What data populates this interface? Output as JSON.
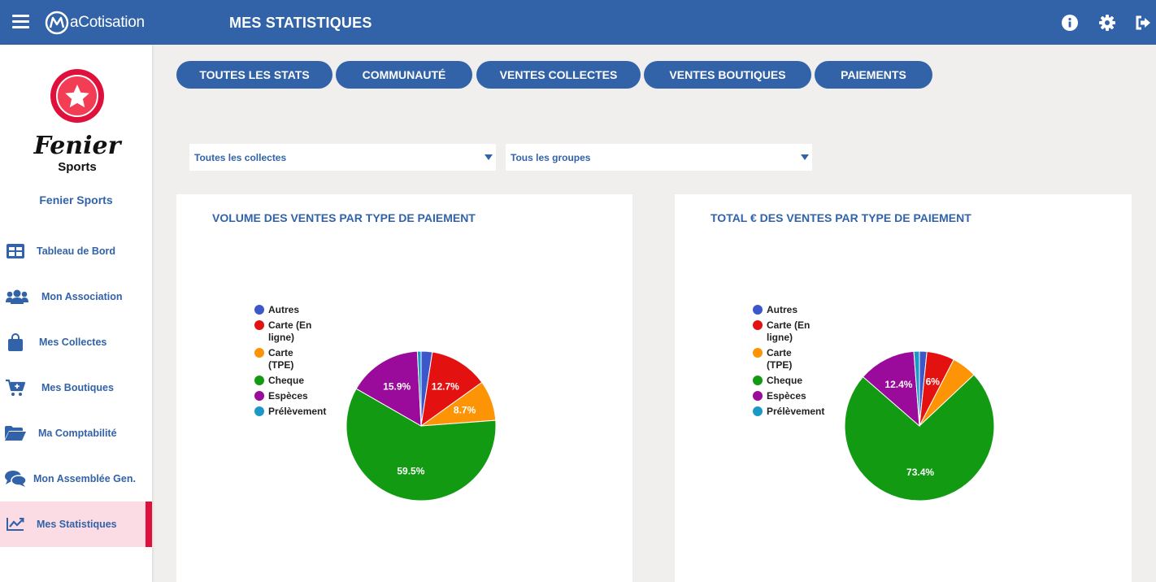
{
  "header": {
    "brand": "aCotisation",
    "title": "MES STATISTIQUES"
  },
  "sidebar": {
    "logo_text_main": "Fenier",
    "logo_text_sub": "Sports",
    "club_name": "Fenier Sports",
    "items": [
      {
        "label": "Tableau de Bord",
        "icon": "dashboard-icon"
      },
      {
        "label": "Mon Association",
        "icon": "users-icon"
      },
      {
        "label": "Mes Collectes",
        "icon": "shopping-bag-icon"
      },
      {
        "label": "Mes Boutiques",
        "icon": "cart-icon"
      },
      {
        "label": "Ma Comptabilité",
        "icon": "folder-icon"
      },
      {
        "label": "Mon Assemblée Gen.",
        "icon": "comments-icon"
      },
      {
        "label": "Mes Statistiques",
        "icon": "chart-line-icon",
        "active": true
      }
    ]
  },
  "tabs": [
    {
      "label": "TOUTES LES STATS"
    },
    {
      "label": "COMMUNAUTÉ"
    },
    {
      "label": "VENTES COLLECTES"
    },
    {
      "label": "VENTES BOUTIQUES"
    },
    {
      "label": "PAIEMENTS"
    }
  ],
  "filters": {
    "collectes": "Toutes les collectes",
    "groupes": "Tous les groupes"
  },
  "colors": {
    "primary": "#3263a8",
    "active_bg": "#fcdce4",
    "active_bar": "#e0103d",
    "autres": "#3b57c9",
    "carte_en_ligne": "#e3110f",
    "carte_tpe": "#fd9405",
    "cheque": "#129a13",
    "especes": "#9a0a9b",
    "prelevement": "#1a99c6"
  },
  "chart_data": [
    {
      "type": "pie",
      "title": "VOLUME DES VENTES PAR TYPE DE PAIEMENT",
      "categories": [
        "Autres",
        "Carte (En ligne)",
        "Carte (TPE)",
        "Cheque",
        "Espèces",
        "Prélèvement"
      ],
      "values": [
        2.4,
        12.7,
        8.7,
        59.5,
        15.9,
        0.8
      ],
      "labels": [
        "",
        "12.7%",
        "8.7%",
        "59.5%",
        "15.9%",
        ""
      ],
      "legend_position": "left"
    },
    {
      "type": "pie",
      "title": "TOTAL € DES VENTES PAR TYPE DE PAIEMENT",
      "categories": [
        "Autres",
        "Carte (En ligne)",
        "Carte (TPE)",
        "Cheque",
        "Espèces",
        "Prélèvement"
      ],
      "values": [
        1.6,
        6.0,
        5.4,
        73.4,
        12.4,
        1.2
      ],
      "labels": [
        "",
        "6%",
        "",
        "73.4%",
        "12.4%",
        ""
      ],
      "legend_position": "left"
    }
  ]
}
